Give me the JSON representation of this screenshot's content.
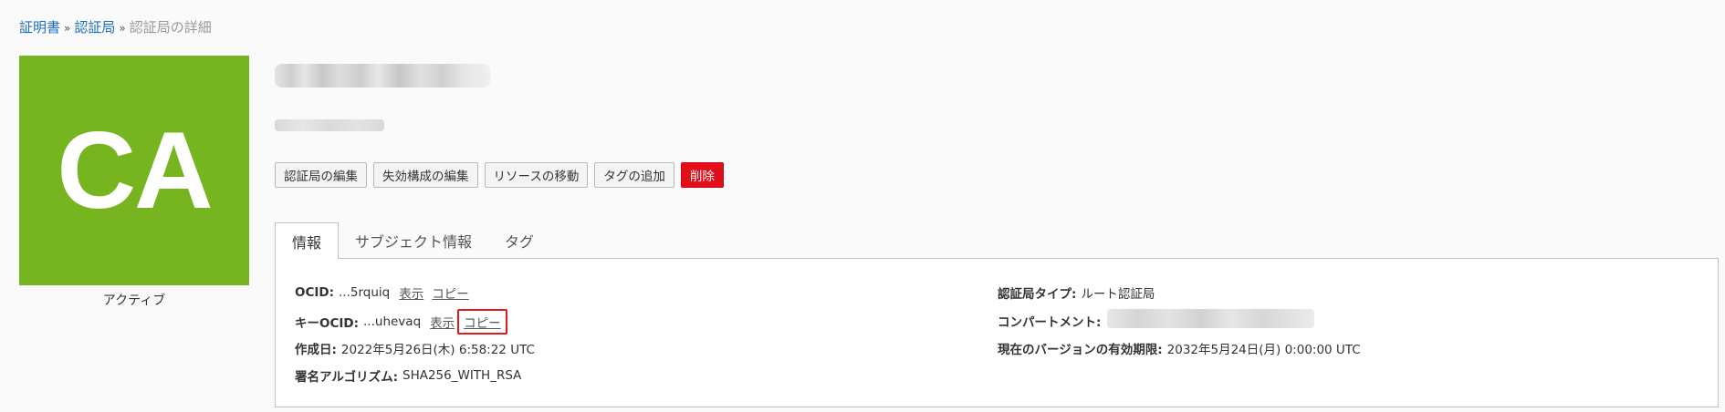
{
  "breadcrumb": {
    "items": [
      "証明書",
      "認証局",
      "認証局の詳細"
    ],
    "separator": "»"
  },
  "ca_tile": {
    "text": "CA",
    "color": "#76b51f",
    "status": "アクティブ"
  },
  "toolbar": {
    "edit_label": "認証局の編集",
    "revocation_label": "失効構成の編集",
    "move_label": "リソースの移動",
    "tag_label": "タグの追加",
    "delete_label": "削除"
  },
  "tabs": [
    {
      "label": "情報",
      "active": true
    },
    {
      "label": "サブジェクト情報",
      "active": false
    },
    {
      "label": "タグ",
      "active": false
    }
  ],
  "info": {
    "ocid": {
      "key": "OCID:",
      "value": "...5rquiq",
      "show": "表示",
      "copy": "コピー"
    },
    "key_ocid": {
      "key": "キーOCID:",
      "value": "...uhevaq",
      "show": "表示",
      "copy": "コピー"
    },
    "created": {
      "key": "作成日:",
      "value": "2022年5月26日(木) 6:58:22 UTC"
    },
    "algorithm": {
      "key": "署名アルゴリズム:",
      "value": "SHA256_WITH_RSA"
    },
    "ca_type": {
      "key": "認証局タイプ:",
      "value": "ルート認証局"
    },
    "compartment": {
      "key": "コンパートメント:"
    },
    "expiry": {
      "key": "現在のバージョンの有効期限:",
      "value": "2032年5月24日(月) 0:00:00 UTC"
    }
  },
  "colors": {
    "accent_link": "#1b6fbf",
    "danger": "#e30d1a",
    "highlight": "#e31a1a"
  }
}
